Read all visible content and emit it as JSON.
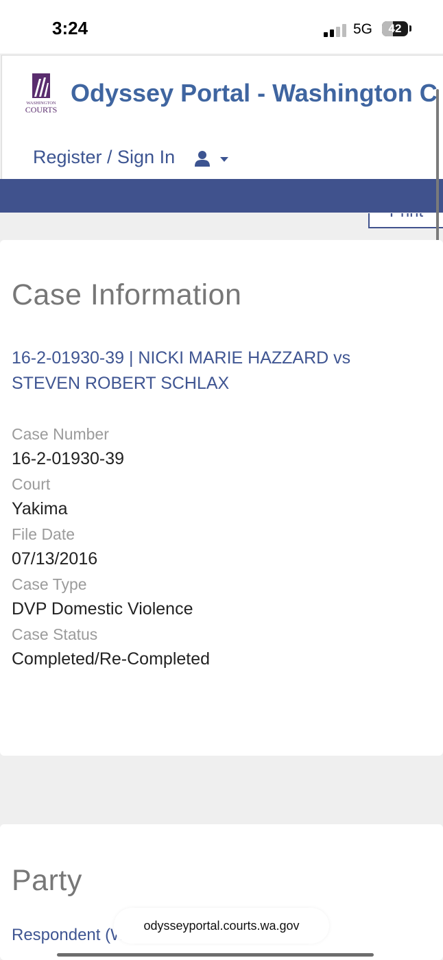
{
  "status": {
    "time": "3:24",
    "network": "5G",
    "battery": "42"
  },
  "header": {
    "logo_text": [
      "WASHINGTON",
      "COURTS"
    ],
    "title": "Odyssey Portal - Washington C",
    "register_label": "Register / Sign In",
    "user_icon": "user-icon",
    "caret_icon": "caret-down-icon"
  },
  "print": {
    "label": "Print"
  },
  "case": {
    "section_title": "Case Information",
    "heading": "16-2-01930-39 | NICKI MARIE HAZZARD vs STEVEN ROBERT SCHLAX",
    "fields": [
      {
        "label": "Case Number",
        "value": "16-2-01930-39"
      },
      {
        "label": "Court",
        "value": "Yakima"
      },
      {
        "label": "File Date",
        "value": "07/13/2016"
      },
      {
        "label": "Case Type",
        "value": "DVP Domestic Violence"
      },
      {
        "label": "Case Status",
        "value": "Completed/Re-Completed"
      }
    ]
  },
  "party": {
    "section_title": "Party",
    "respondent_label": "Respondent (WIF)"
  },
  "browser": {
    "url": "odysseyportal.courts.wa.gov"
  },
  "colors": {
    "brand_blue": "#3f65a0",
    "navbar": "#40528d",
    "logo_purple": "#5a2d6e"
  }
}
